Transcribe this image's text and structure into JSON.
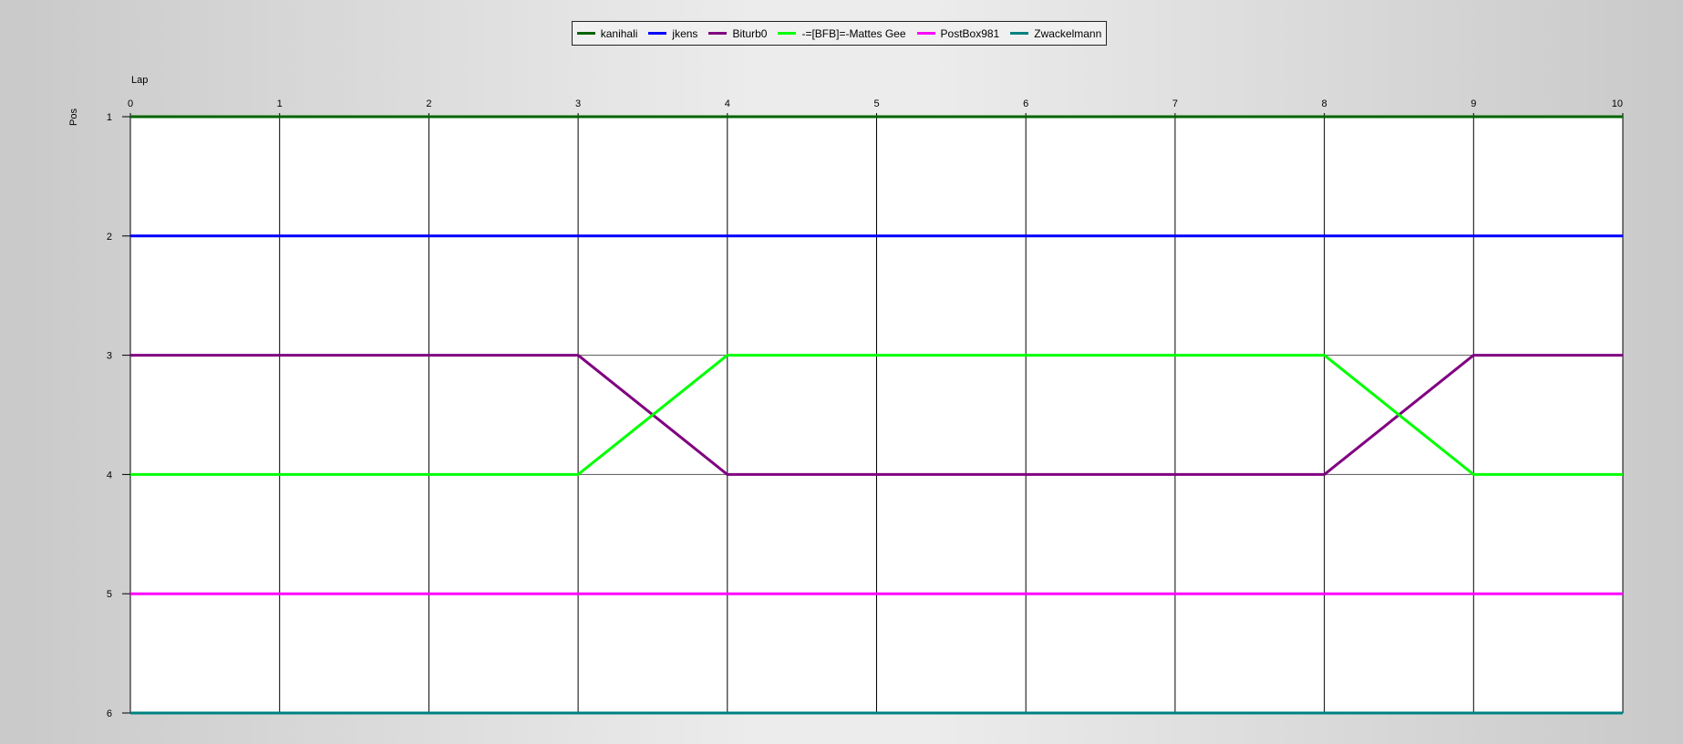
{
  "chart_data": {
    "type": "line",
    "xlabel": "Lap",
    "ylabel": "Pos",
    "x": [
      0,
      1,
      2,
      3,
      4,
      5,
      6,
      7,
      8,
      9,
      10
    ],
    "xlim": [
      0,
      10
    ],
    "ylim": [
      1,
      6
    ],
    "y_inverted": true,
    "x_ticks": [
      "0",
      "1",
      "2",
      "3",
      "4",
      "5",
      "6",
      "7",
      "8",
      "9",
      "10"
    ],
    "y_ticks": [
      "1",
      "2",
      "3",
      "4",
      "5",
      "6"
    ],
    "grid": true,
    "legend_position": "top-center",
    "series": [
      {
        "name": "kanihali",
        "color": "#006400",
        "values": [
          1,
          1,
          1,
          1,
          1,
          1,
          1,
          1,
          1,
          1,
          1
        ]
      },
      {
        "name": "jkens",
        "color": "#0000ff",
        "values": [
          2,
          2,
          2,
          2,
          2,
          2,
          2,
          2,
          2,
          2,
          2
        ]
      },
      {
        "name": "Biturb0",
        "color": "#800080",
        "values": [
          3,
          3,
          3,
          3,
          4,
          4,
          4,
          4,
          4,
          3,
          3
        ]
      },
      {
        "name": "-=[BFB]=-Mattes Gee",
        "color": "#00ff00",
        "values": [
          4,
          4,
          4,
          4,
          3,
          3,
          3,
          3,
          3,
          4,
          4
        ]
      },
      {
        "name": "PostBox981",
        "color": "#ff00ff",
        "values": [
          5,
          5,
          5,
          5,
          5,
          5,
          5,
          5,
          5,
          5,
          5
        ]
      },
      {
        "name": "Zwackelmann",
        "color": "#008080",
        "values": [
          6,
          6,
          6,
          6,
          6,
          6,
          6,
          6,
          6,
          6,
          6
        ]
      }
    ]
  }
}
